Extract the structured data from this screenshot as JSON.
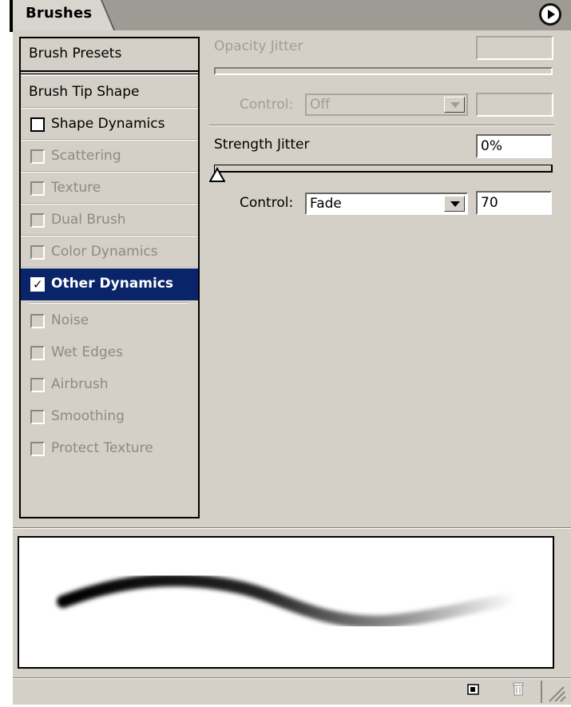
{
  "panel": {
    "tab_title": "Brushes"
  },
  "list": {
    "presets_label": "Brush Presets",
    "items": [
      {
        "label": "Brush Tip Shape",
        "checkbox": false,
        "checked": false,
        "enabled": true,
        "selected": false
      },
      {
        "label": "Shape Dynamics",
        "checkbox": true,
        "checked": false,
        "enabled": true,
        "selected": false
      },
      {
        "label": "Scattering",
        "checkbox": true,
        "checked": false,
        "enabled": false,
        "selected": false
      },
      {
        "label": "Texture",
        "checkbox": true,
        "checked": false,
        "enabled": false,
        "selected": false
      },
      {
        "label": "Dual Brush",
        "checkbox": true,
        "checked": false,
        "enabled": false,
        "selected": false
      },
      {
        "label": "Color Dynamics",
        "checkbox": true,
        "checked": false,
        "enabled": false,
        "selected": false
      },
      {
        "label": "Other Dynamics",
        "checkbox": true,
        "checked": true,
        "enabled": true,
        "selected": true
      },
      {
        "label": "Noise",
        "checkbox": true,
        "checked": false,
        "enabled": false,
        "selected": false
      },
      {
        "label": "Wet Edges",
        "checkbox": true,
        "checked": false,
        "enabled": false,
        "selected": false
      },
      {
        "label": "Airbrush",
        "checkbox": true,
        "checked": false,
        "enabled": false,
        "selected": false
      },
      {
        "label": "Smoothing",
        "checkbox": true,
        "checked": false,
        "enabled": false,
        "selected": false
      },
      {
        "label": "Protect Texture",
        "checkbox": true,
        "checked": false,
        "enabled": false,
        "selected": false
      }
    ]
  },
  "opacity": {
    "label": "Opacity Jitter",
    "value": "",
    "control_label": "Control:",
    "control_value": "Off",
    "control_amount": ""
  },
  "strength": {
    "label": "Strength Jitter",
    "value": "0%",
    "slider_fraction": 0,
    "control_label": "Control:",
    "control_value": "Fade",
    "control_amount": "70"
  },
  "icons": {
    "menu": "flyout-menu-arrow-icon",
    "new": "new-brush-icon",
    "trash": "trash-icon",
    "resize": "resize-grip-icon"
  }
}
